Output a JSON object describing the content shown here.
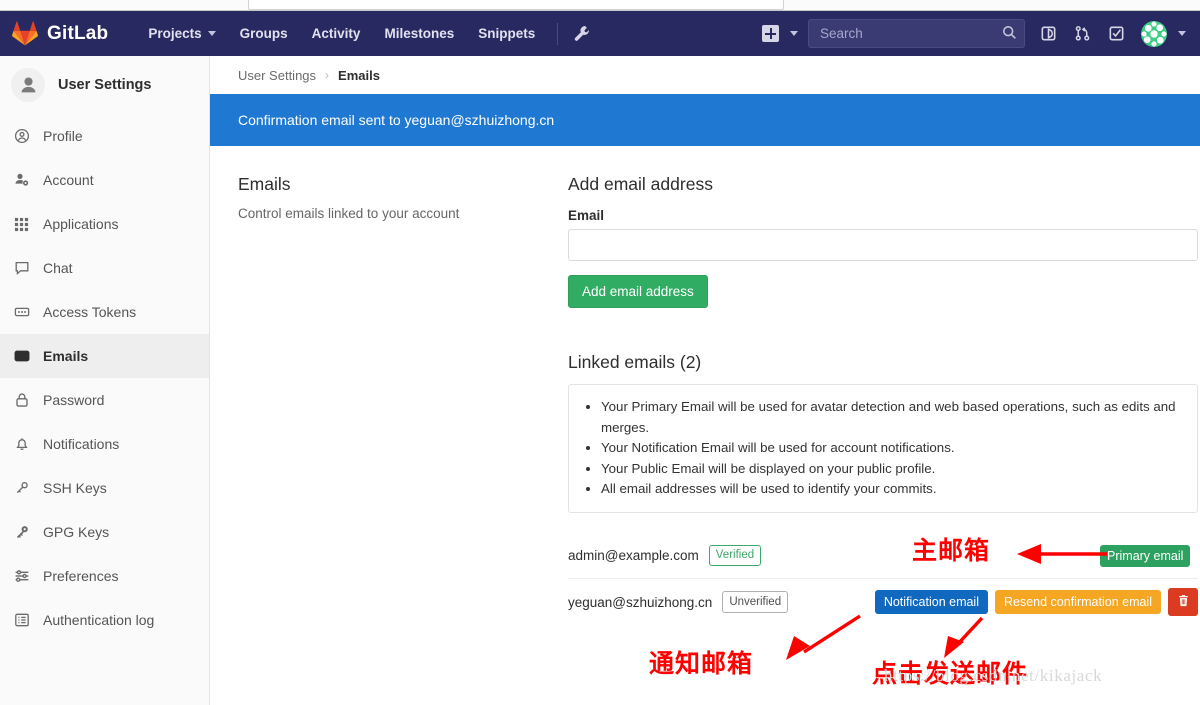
{
  "browser": {
    "omnibox_value": ""
  },
  "navbar": {
    "brand": "GitLab",
    "brand_logo_icon": "gitlab-tanuki-logo-icon",
    "links": [
      {
        "label": "Projects",
        "has_caret": true
      },
      {
        "label": "Groups",
        "has_caret": false
      },
      {
        "label": "Activity",
        "has_caret": false
      },
      {
        "label": "Milestones",
        "has_caret": false
      },
      {
        "label": "Snippets",
        "has_caret": false
      }
    ],
    "admin_icon": "wrench-icon",
    "new_icon": "plus-square-icon",
    "new_caret_icon": "chevron-down-icon",
    "search": {
      "placeholder": "Search",
      "value": "",
      "icon": "search-icon"
    },
    "right_icons": [
      {
        "name": "issues-icon"
      },
      {
        "name": "merge-requests-icon"
      },
      {
        "name": "todos-icon"
      }
    ],
    "avatar": {
      "icon": "user-avatar",
      "caret_icon": "chevron-down-icon"
    },
    "bg_color": "#292961"
  },
  "sidebar": {
    "header": {
      "title": "User Settings",
      "avatar_icon": "user-avatar-icon"
    },
    "items": [
      {
        "label": "Profile",
        "icon": "profile-icon",
        "active": false
      },
      {
        "label": "Account",
        "icon": "account-icon",
        "active": false
      },
      {
        "label": "Applications",
        "icon": "applications-grid-icon",
        "active": false
      },
      {
        "label": "Chat",
        "icon": "chat-bubble-icon",
        "active": false
      },
      {
        "label": "Access Tokens",
        "icon": "token-icon",
        "active": false
      },
      {
        "label": "Emails",
        "icon": "envelope-icon",
        "active": true
      },
      {
        "label": "Password",
        "icon": "lock-icon",
        "active": false
      },
      {
        "label": "Notifications",
        "icon": "bell-icon",
        "active": false
      },
      {
        "label": "SSH Keys",
        "icon": "key-icon",
        "active": false
      },
      {
        "label": "GPG Keys",
        "icon": "key-icon",
        "active": false
      },
      {
        "label": "Preferences",
        "icon": "sliders-icon",
        "active": false
      },
      {
        "label": "Authentication log",
        "icon": "log-list-icon",
        "active": false
      }
    ]
  },
  "breadcrumb": {
    "parent": "User Settings",
    "separator": "›",
    "current": "Emails"
  },
  "alert": {
    "message": "Confirmation email sent to yeguan@szhuizhong.cn",
    "bg_color": "#1f78d1"
  },
  "emails_section": {
    "title": "Emails",
    "subtitle": "Control emails linked to your account"
  },
  "add_email": {
    "title": "Add email address",
    "field_label": "Email",
    "input_value": "",
    "input_placeholder": "",
    "submit_label": "Add email address",
    "submit_color": "#31ad63"
  },
  "linked_emails": {
    "title": "Linked emails (2)",
    "notes": [
      "Your Primary Email will be used for avatar detection and web based operations, such as edits and merges.",
      "Your Notification Email will be used for account notifications.",
      "Your Public Email will be displayed on your public profile.",
      "All email addresses will be used to identify your commits."
    ],
    "rows": [
      {
        "address": "admin@example.com",
        "status_badge": "Verified",
        "status_type": "verified",
        "actions": []
      },
      {
        "address": "yeguan@szhuizhong.cn",
        "status_badge": "Unverified",
        "status_type": "unverified",
        "actions": [
          {
            "label": "Notification email",
            "style": "blue"
          },
          {
            "label": "Resend confirmation email",
            "style": "orange"
          },
          {
            "label": "",
            "style": "trash",
            "icon": "trash-icon"
          }
        ]
      }
    ]
  },
  "annotations": {
    "color": "#ff0000",
    "primary_label": "主邮箱",
    "primary_callout_badge": "Primary email",
    "notification_label": "通知邮箱",
    "click_send_label": "点击发送邮件",
    "watermark": "https://blog.csdn.net/kikajack"
  }
}
